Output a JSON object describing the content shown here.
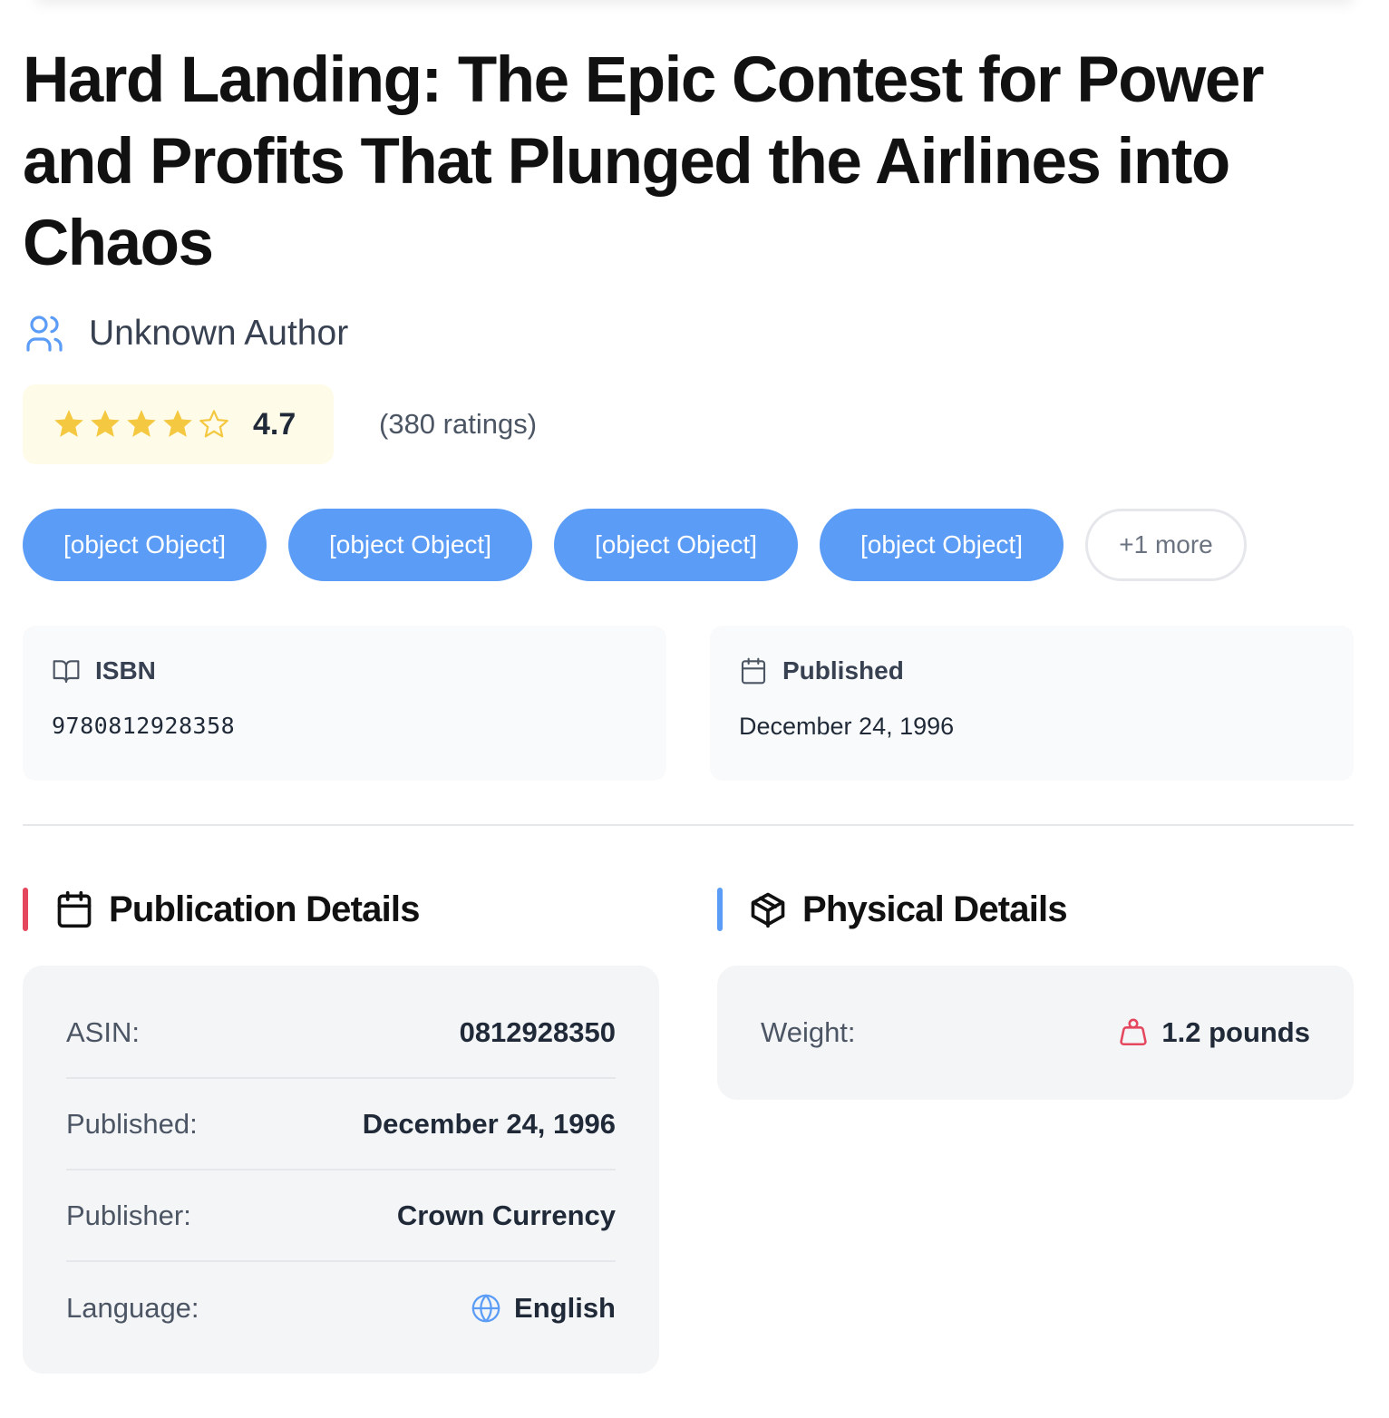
{
  "book": {
    "title": "Hard Landing: The Epic Contest for Power and Profits That Plunged the Airlines into Chaos",
    "author": "Unknown Author",
    "author_icon": "users-icon"
  },
  "rating": {
    "value": "4.7",
    "count_text": "(380 ratings)",
    "stars_filled": 4,
    "stars_total": 5,
    "star_color": "#f5c842"
  },
  "tags": {
    "items": [
      "[object Object]",
      "[object Object]",
      "[object Object]",
      "[object Object]"
    ],
    "more_label": "+1 more",
    "color": "#5b9cf6"
  },
  "info_cards": {
    "isbn": {
      "label": "ISBN",
      "value": "9780812928358",
      "icon": "book-open-icon"
    },
    "published": {
      "label": "Published",
      "value": "December 24, 1996",
      "icon": "calendar-icon"
    }
  },
  "publication_details": {
    "title": "Publication Details",
    "icon": "calendar-icon",
    "accent": "#e5485e",
    "rows": [
      {
        "key": "ASIN:",
        "value": "0812928350"
      },
      {
        "key": "Published:",
        "value": "December 24, 1996"
      },
      {
        "key": "Publisher:",
        "value": "Crown Currency"
      },
      {
        "key": "Language:",
        "value": "English",
        "icon": "globe-icon"
      }
    ]
  },
  "physical_details": {
    "title": "Physical Details",
    "icon": "package-icon",
    "accent": "#5b9cf6",
    "rows": [
      {
        "key": "Weight:",
        "value": "1.2 pounds",
        "icon": "weight-icon"
      }
    ]
  }
}
